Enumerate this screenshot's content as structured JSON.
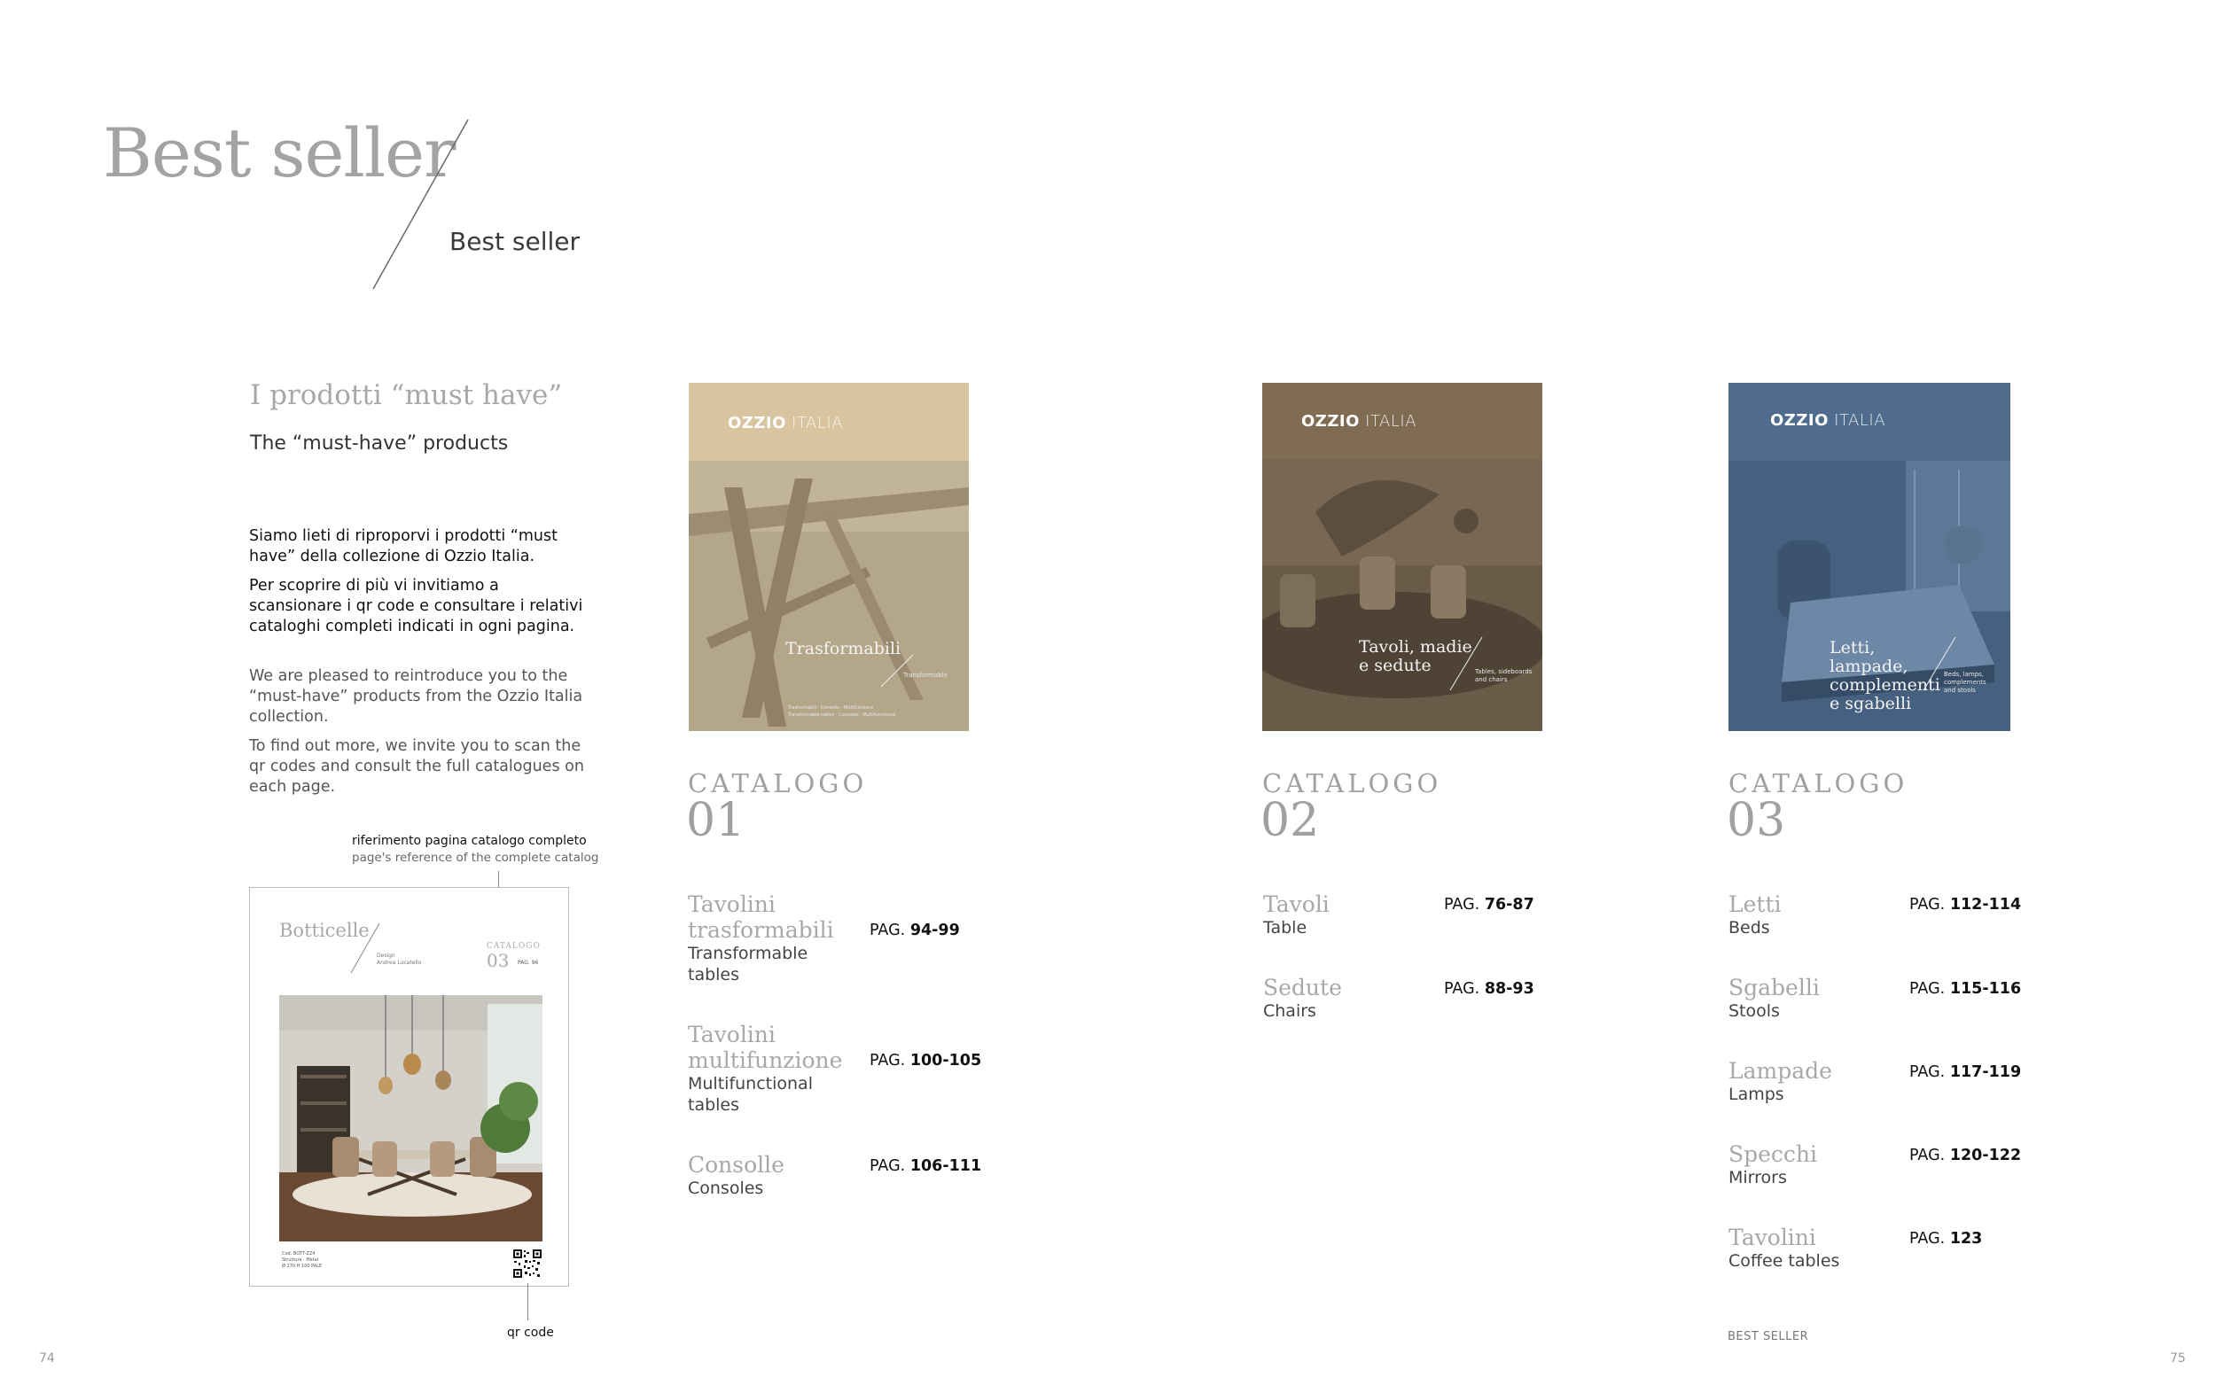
{
  "header": {
    "title": "Best seller",
    "subtitle": "Best seller"
  },
  "intro": {
    "heading_it": "I prodotti “must have”",
    "heading_en": "The “must-have” products",
    "para_it_1": "Siamo lieti di riproporvi i prodotti “must have” della collezione di Ozzio Italia.",
    "para_it_2": "Per scoprire di più vi invitiamo a scansionare i qr code e consultare i relativi cataloghi completi indicati in ogni pagina.",
    "para_en_1": "We are pleased to reintroduce you to the “must-have” products from the Ozzio Italia collection.",
    "para_en_2": "To find out more, we invite you to scan the qr codes and consult the full catalogues on each page."
  },
  "sample_page": {
    "ref_it": "riferimento pagina catalogo completo",
    "ref_en": "page's reference of the complete catalog",
    "product_name": "Botticelle",
    "design_label": "Design",
    "designer": "Andrea Lucatello",
    "catalog_label": "CATALOGO",
    "catalog_num": "03",
    "catalog_pag": "PAG. 96",
    "foot_line_1": "Cod. BOTT-ZZ4",
    "foot_line_2": "Struttura · Metal",
    "foot_line_3": "Ø 170 H 100 PALE",
    "qr_label": "qr code"
  },
  "catalogs": [
    {
      "brand_bold": "OZZIO",
      "brand_light": "ITALIA",
      "cover_title": "Trasformabili",
      "cover_small_1": "Transformable",
      "cover_small_2": "Trasformabili · Consolle · Multifunzione",
      "cover_small_3": "Transformable tables · Consoles · Multifunctional",
      "colors": {
        "top": "#d9c4a0",
        "body": "#b7a88a"
      },
      "label": "CATALOGO",
      "number": "01",
      "items": [
        {
          "it": "Tavolini trasformabili",
          "en": "Transformable tables",
          "pag_prefix": "PAG.",
          "pag": "94-99"
        },
        {
          "it": "Tavolini multifunzione",
          "en": "Multifunctional tables",
          "pag_prefix": "PAG.",
          "pag": "100-105"
        },
        {
          "it": "Consolle",
          "en": "Consoles",
          "pag_prefix": "PAG.",
          "pag": "106-111"
        }
      ]
    },
    {
      "brand_bold": "OZZIO",
      "brand_light": "ITALIA",
      "cover_title": "Tavoli, madie e sedute",
      "cover_small_1": "Tables, sideboards and chairs",
      "colors": {
        "top": "#7f6c53",
        "body": "#6e5f4b"
      },
      "label": "CATALOGO",
      "number": "02",
      "items": [
        {
          "it": "Tavoli",
          "en": "Table",
          "pag_prefix": "PAG.",
          "pag": "76-87"
        },
        {
          "it": "Sedute",
          "en": "Chairs",
          "pag_prefix": "PAG.",
          "pag": "88-93"
        }
      ]
    },
    {
      "brand_bold": "OZZIO",
      "brand_light": "ITALIA",
      "cover_title": "Letti, lampade, complementi e sgabelli",
      "cover_small_1": "Beds, lamps, complements and stools",
      "colors": {
        "top": "#4f6c8f",
        "body": "#4a6688"
      },
      "label": "CATALOGO",
      "number": "03",
      "items": [
        {
          "it": "Letti",
          "en": "Beds",
          "pag_prefix": "PAG.",
          "pag": "112-114"
        },
        {
          "it": "Sgabelli",
          "en": "Stools",
          "pag_prefix": "PAG.",
          "pag": "115-116"
        },
        {
          "it": "Lampade",
          "en": "Lamps",
          "pag_prefix": "PAG.",
          "pag": "117-119"
        },
        {
          "it": "Specchi",
          "en": "Mirrors",
          "pag_prefix": "PAG.",
          "pag": "120-122"
        },
        {
          "it": "Tavolini",
          "en": "Coffee tables",
          "pag_prefix": "PAG.",
          "pag": "123"
        }
      ]
    }
  ],
  "footer": {
    "section_label": "BEST SELLER",
    "page_left": "74",
    "page_right": "75"
  }
}
